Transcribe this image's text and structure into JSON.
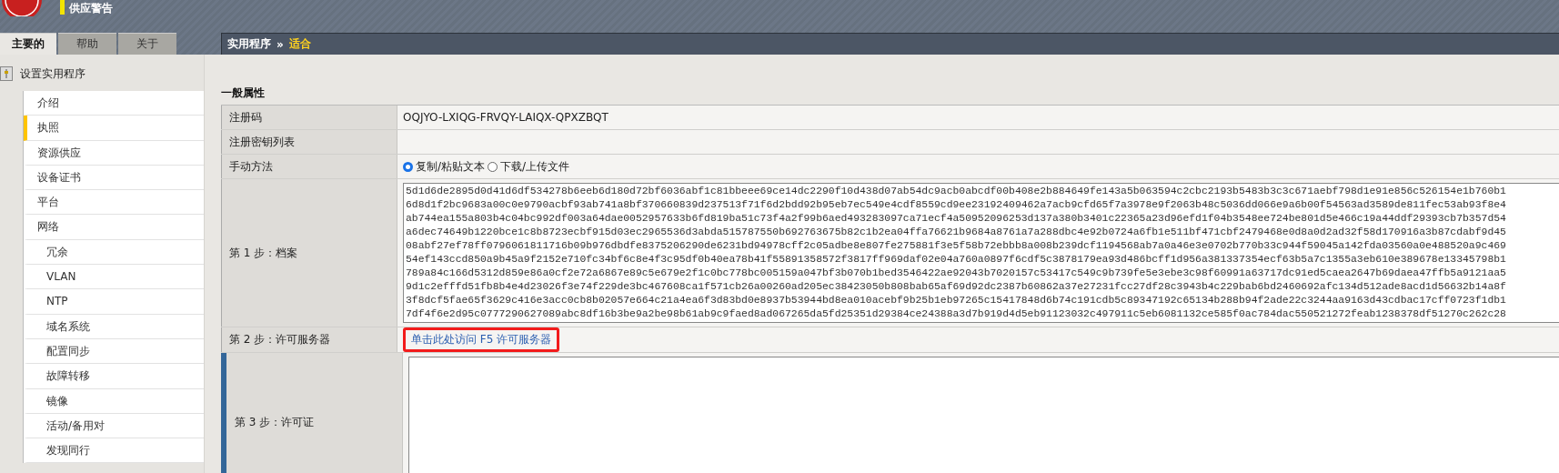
{
  "header": {
    "title": "供应警告"
  },
  "tabs": [
    {
      "label": "主要的",
      "selected": true
    },
    {
      "label": "帮助",
      "selected": false
    },
    {
      "label": "关于",
      "selected": false
    }
  ],
  "breadcrumb": {
    "items": [
      "实用程序",
      "适合"
    ],
    "separator": "»"
  },
  "sidebar": {
    "title": "设置实用程序",
    "items": [
      {
        "label": "介绍",
        "selected": false
      },
      {
        "label": "执照",
        "selected": true
      },
      {
        "label": "资源供应",
        "selected": false
      },
      {
        "label": "设备证书",
        "selected": false
      },
      {
        "label": "平台",
        "selected": false
      },
      {
        "label": "网络",
        "selected": false,
        "children": [
          {
            "label": "冗余",
            "selected": false
          },
          {
            "label": "VLAN",
            "selected": false
          },
          {
            "label": "NTP",
            "selected": false
          },
          {
            "label": "域名系统",
            "selected": false
          },
          {
            "label": "配置同步",
            "selected": false
          },
          {
            "label": "故障转移",
            "selected": false
          },
          {
            "label": "镜像",
            "selected": false
          },
          {
            "label": "活动/备用对",
            "selected": false
          },
          {
            "label": "发现同行",
            "selected": false
          }
        ]
      }
    ]
  },
  "section": {
    "title": "一般属性"
  },
  "rows": [
    {
      "kind": "text",
      "label": "注册码",
      "value": "OQJYO-LXIQG-FRVQY-LAIQX-QPXZBQT"
    },
    {
      "kind": "text",
      "label": "注册密钥列表"
    },
    {
      "kind": "radio",
      "label": "手动方法",
      "options": [
        {
          "label": "复制/粘贴文本",
          "selected": true
        },
        {
          "label": "下载/上传文件",
          "selected": false
        }
      ]
    },
    {
      "kind": "textarea",
      "label": "第 1 步：档案",
      "lines": [
        "5d1d6de2895d0d41d6df534278b6eeb6d180d72bf6036abf1c81bbeee69ce14dc2290f10d438d07ab54dc9acb0abcdf00b408e2b884649fe143a5b063594c2cbc2193b5483b3c3c671aebf798d1e91e856c526154e1b760b1",
        "6d8d1f2bc9683a00c0e9790acbf93ab741a8bf370660839d237513f71f6d2bdd92b95eb7ec549e4cdf8559cd9ee23192409462a7acb9cfd65f7a3978e9f2063b48c5036dd066e9a6b00f54563ad3589de811fec53ab93f8e4",
        "ab744ea155a803b4c04bc992df003a64dae0052957633b6fd819ba51c73f4a2f99b6aed493283097ca71ecf4a50952096253d137a380b3401c22365a23d96efd1f04b3548ee724be801d5e466c19a44ddf29393cb7b357d54",
        "a6dec74649b1220bce1c8b8723ecbf915d03ec2965536d3abda515787550b692763675b82c1b2ea04ffa76621b9684a8761a7a288dbc4e92b0724a6fb1e511bf471cbf2479468e0d8a0d2ad32f58d170916a3b87cdabf9d45",
        "08abf27ef78ff0796061811716b09b976dbdfe8375206290de6231bd94978cff2c05adbe8e807fe275881f3e5f58b72ebbb8a008b239dcf1194568ab7a0a46e3e0702b770b33c944f59045a142fda03560a0e488520a9c469",
        "54ef143ccd850a9b45a9f2152e710fc34bf6c8e4f3c95df0b40ea78b41f55891358572f3817ff969daf02e04a760a0897f6cdf5c3878179ea93d486bcff1d956a381337354ecf63b5a7c1355a3eb610e389678e13345798b1",
        "789a84c166d5312d859e86a0cf2e72a6867e89c5e679e2f1c0bc778bc005159a047bf3b070b1bed3546422ae92043b7020157c53417c549c9b739fe5e3ebe3c98f60991a63717dc91ed5caea2647b69daea47ffb5a9121aa5",
        "9d1c2efffd51fb8b4e4d23026f3e74f229de3bc467608ca1f571cb26a00260ad205ec38423050b808bab65af69d92dc2387b60862a37e27231fcc27df28c3943b4c229bab6bd2460692afc134d512ade8acd1d56632b14a8f",
        "3f8dcf5fae65f3629c416e3acc0cb8b02057e664c21a4ea6f3d83bd0e8937b53944bd8ea010acebf9b25b1eb97265c15417848d6b74c191cdb5c89347192c65134b288b94f2ade22c3244aa9163d43cdbac17cff0723f1db1",
        "7df4f6e2d95c0777290627089abc8df16b3be9a2be98b61ab9c9faed8ad067265da5fd25351d29384ce24388a3d7b919d4d5eb91123032c497911c5eb6081132ce585f0ac784dac550521272feab1238378df51270c262c28"
      ]
    },
    {
      "kind": "link",
      "label": "第 2 步：许可服务器",
      "value": "单击此处访问 F5 许可服务器",
      "highlighted": true
    },
    {
      "kind": "textarea",
      "label": "第 3 步：许可证",
      "lines": [],
      "focused": true
    }
  ]
}
